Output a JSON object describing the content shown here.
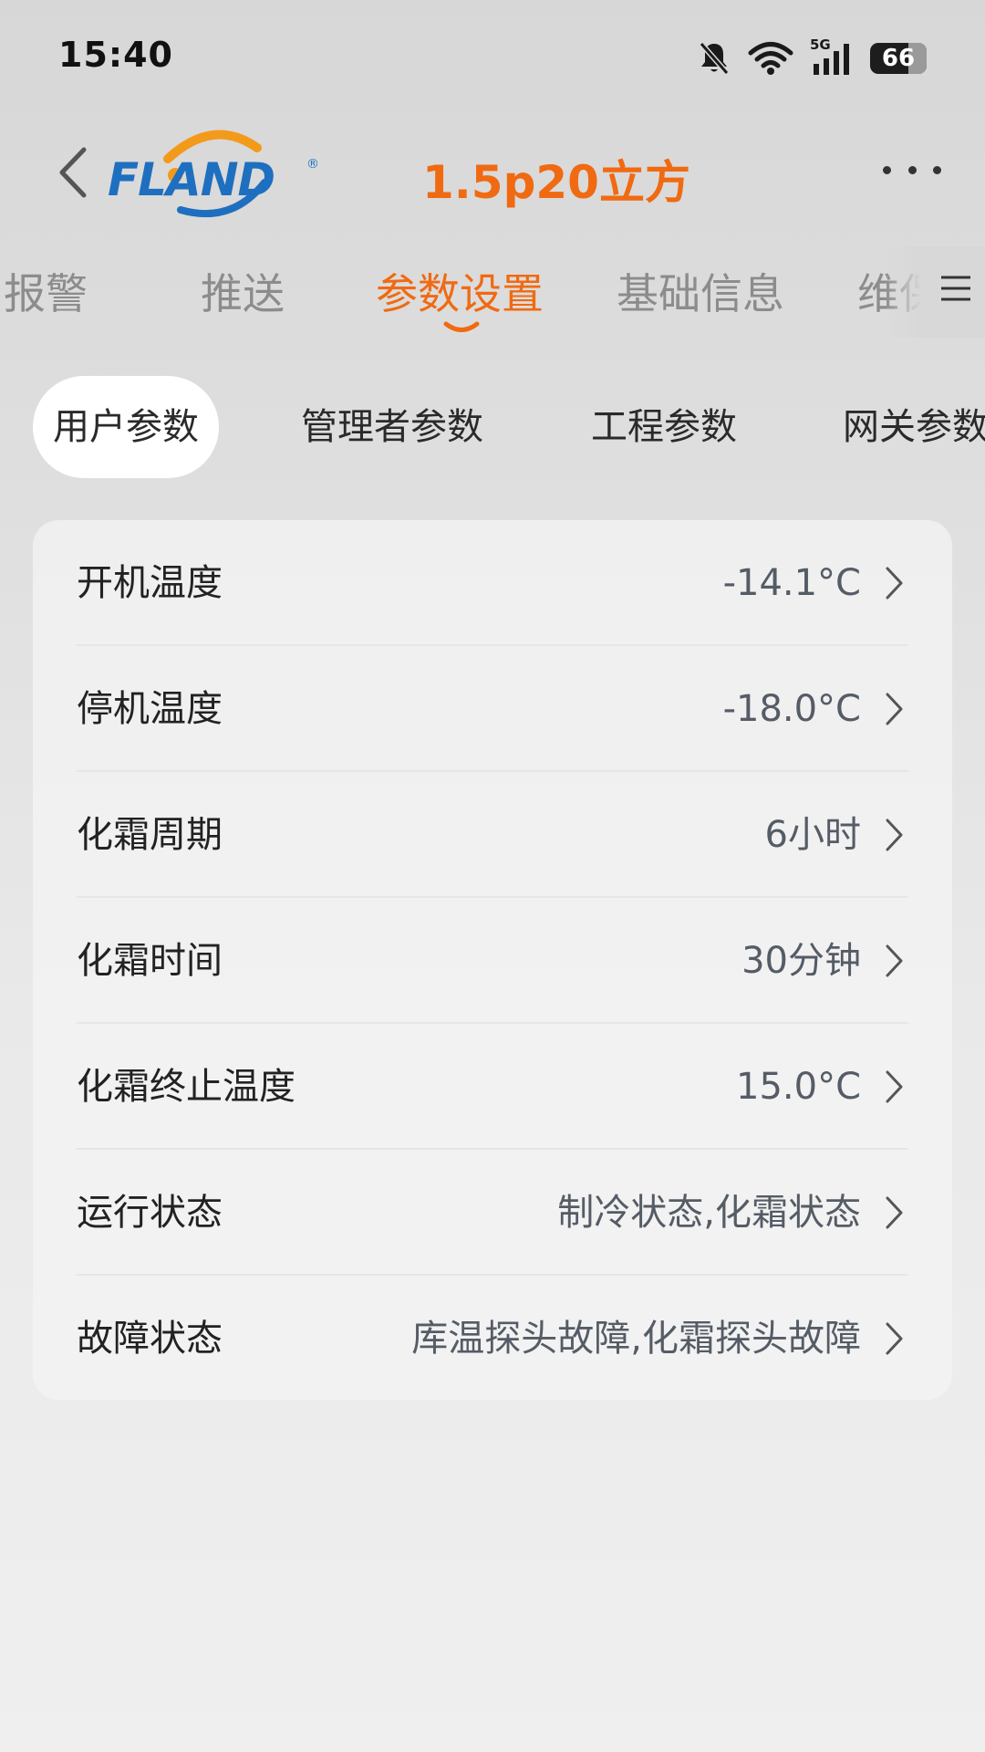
{
  "status_bar": {
    "time": "15:40",
    "network": "5G",
    "battery": "66",
    "icons": [
      "bell-off-icon",
      "wifi-icon",
      "signal-icon",
      "battery-icon"
    ]
  },
  "header": {
    "logo_text": "FLAND",
    "logo_mark": "®",
    "title": "1.5p20立方",
    "colors": {
      "accent": "#f06a12",
      "brand_blue": "#1e6fbf"
    }
  },
  "main_tabs": [
    {
      "label": "报警",
      "active": false
    },
    {
      "label": "推送",
      "active": false
    },
    {
      "label": "参数设置",
      "active": true
    },
    {
      "label": "基础信息",
      "active": false
    },
    {
      "label": "维保",
      "active": false
    }
  ],
  "sub_tabs": [
    {
      "label": "用户参数",
      "active": true
    },
    {
      "label": "管理者参数",
      "active": false
    },
    {
      "label": "工程参数",
      "active": false
    },
    {
      "label": "网关参数",
      "active": false
    }
  ],
  "settings": [
    {
      "label": "开机温度",
      "value": "-14.1°C"
    },
    {
      "label": "停机温度",
      "value": "-18.0°C"
    },
    {
      "label": "化霜周期",
      "value": "6小时"
    },
    {
      "label": "化霜时间",
      "value": "30分钟"
    },
    {
      "label": "化霜终止温度",
      "value": "15.0°C"
    },
    {
      "label": "运行状态",
      "value": "制冷状态,化霜状态"
    },
    {
      "label": "故障状态",
      "value": "库温探头故障,化霜探头故障"
    }
  ]
}
